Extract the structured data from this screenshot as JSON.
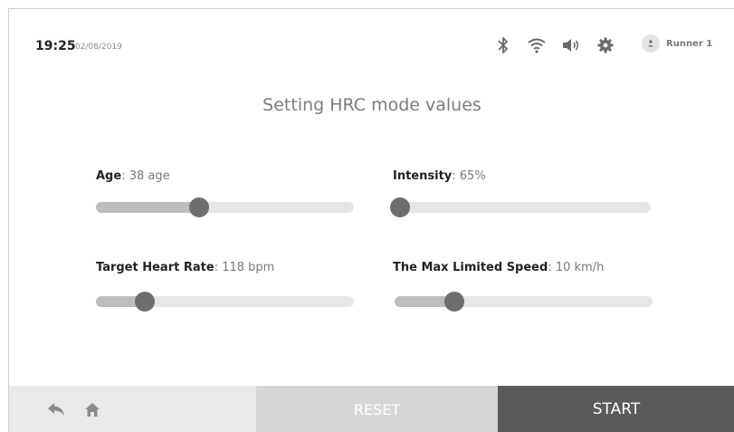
{
  "status_bar": {
    "time": "19:25",
    "date": "02/08/2019",
    "icons": [
      "bluetooth-icon",
      "wifi-icon",
      "volume-icon",
      "gear-icon",
      "user-icon"
    ],
    "user_name": "Runner 1"
  },
  "title": "Setting HRC mode values",
  "settings": {
    "age": {
      "label": "Age",
      "value": ": 38 age",
      "level": 0.4
    },
    "intensity": {
      "label": "Intensity",
      "value": ": 65%",
      "level": 0.0
    },
    "target_heart_rate": {
      "label": "Target Heart Rate",
      "value": ": 118 bpm",
      "level": 0.19
    },
    "max_speed": {
      "label": "The Max Limited Speed",
      "value": ": 10 km/h",
      "level": 0.23
    }
  },
  "bottom_bar": {
    "reset_label": "RESET",
    "start_label": "START"
  },
  "colors": {
    "thumb": "#6e6e6e",
    "track": "#e6e6e6",
    "start_bg": "#5a5a5a",
    "reset_bg": "#d6d6d6"
  }
}
